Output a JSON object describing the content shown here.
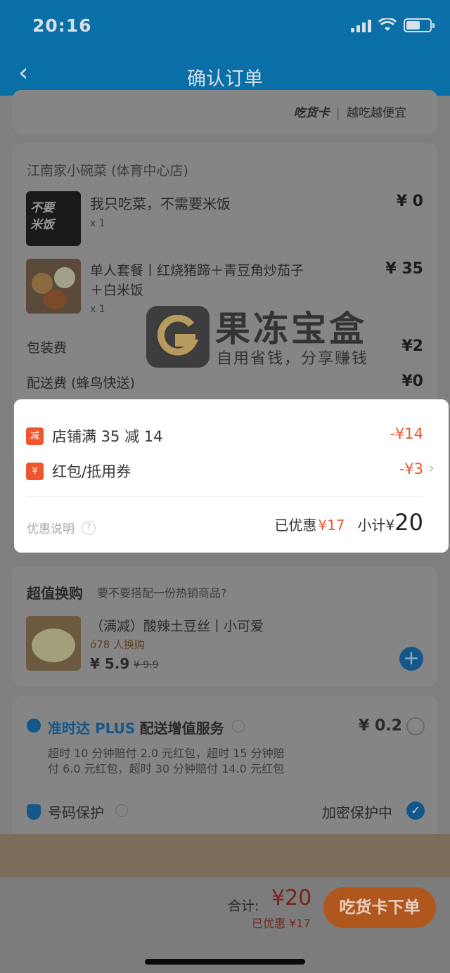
{
  "status": {
    "time": "20:16"
  },
  "nav": {
    "title": "确认订单"
  },
  "top_card": {
    "card_brand": "吃货卡",
    "card_slogan": "越吃越便宜"
  },
  "store": {
    "name": "江南家小碗菜 (体育中心店)",
    "items": [
      {
        "thumb_text": "不要 米饭",
        "name": "我只吃菜，不需要米饭",
        "qty": "x 1",
        "price": "¥ 0"
      },
      {
        "name_line1": "单人套餐丨红烧猪蹄＋青豆角炒茄子",
        "name_line2": "＋白米饭",
        "qty": "x 1",
        "price": "¥ 35"
      }
    ],
    "packing_label": "包装费",
    "packing_price": "¥2",
    "delivery_label": "配送费 (蜂鸟快送)",
    "delivery_price": "¥0"
  },
  "discounts": {
    "rows": [
      {
        "badge": "减",
        "label": "店铺满 35 减 14",
        "amount": "-¥14"
      },
      {
        "badge": "¥",
        "label": "红包/抵用券",
        "amount": "-¥3"
      }
    ],
    "info_label": "优惠说明",
    "saved_label": "已优惠",
    "saved_amount": "¥17",
    "subtotal_label": "小计",
    "subtotal_currency": "¥",
    "subtotal_amount": "20"
  },
  "upsell": {
    "title": "超值换购",
    "subtitle": "要不要搭配一份热销商品?",
    "item_name": "（满减）酸辣土豆丝丨小可爱",
    "item_exchanged": "78 人换购",
    "item_price": "¥ 5.9",
    "item_old_price": "¥ 9.9"
  },
  "services": {
    "ontime_brand": "准时达 PLUS",
    "ontime_label": "配送增值服务",
    "ontime_price": "¥ 0.2",
    "ontime_desc1": "超时 10 分钟赔付 2.0 元红包，超时 15 分钟赔",
    "ontime_desc2": "付 6.0 元红包，超时 30 分钟赔付 14.0 元红包",
    "phone_label": "号码保护",
    "phone_status": "加密保护中"
  },
  "footer": {
    "total_label": "合计:",
    "total_amount": "¥20",
    "saved_text": "已优惠 ¥17",
    "button_label": "吃货卡下单"
  },
  "watermark": {
    "title": "果冻宝盒",
    "subtitle": "自用省钱，分享赚钱"
  },
  "colors": {
    "accent_red": "#f0552e",
    "nav_blue": "#0a6fa6",
    "order_orange": "#b0571e",
    "link_blue": "#1f6fb0"
  }
}
